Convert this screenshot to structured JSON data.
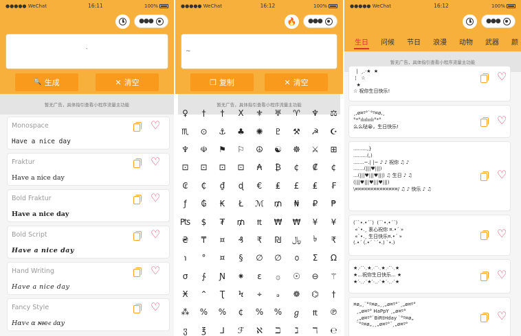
{
  "status": {
    "carrier": "●●●●● WeChat",
    "battery": "100%"
  },
  "phones": [
    {
      "time": "16:11"
    },
    {
      "time": "16:12"
    },
    {
      "time": "16:12"
    }
  ],
  "colors": {
    "theme": "#f7b03c",
    "button": "#f99a1c",
    "heart": "#e8395a",
    "active_tab": "#d9342b"
  },
  "icons": {
    "copy": "copy-icon",
    "favorite": "heart-icon",
    "history": "clock-icon",
    "hot": "fire-icon",
    "more": "more-dots-icon",
    "close": "target-icon"
  },
  "editor": {
    "p1_value": "`",
    "p2_value": "~"
  },
  "actions": {
    "generate": "生成",
    "clear": "清空",
    "copy": "复制",
    "generate_icon": "🔍",
    "clear_icon": "✕",
    "copy_icon": "❐"
  },
  "ad_text": "暂无广告，具体指引查看小程序流量主功能",
  "fonts": [
    {
      "name": "Monospace",
      "sample": "Have a nice day"
    },
    {
      "name": "Fraktur",
      "sample": "Have a nice day"
    },
    {
      "name": "Bold Fraktur",
      "sample": "Have a nice day"
    },
    {
      "name": "Bold Script",
      "sample": "Have a nice day"
    },
    {
      "name": "Hand Writing",
      "sample": "Have a nice day"
    },
    {
      "name": "Fancy Style",
      "sample": "Hɑᴠҽ ɑ ɴ̶ɪ̶ᴄ̶ҽ ԁɑу"
    }
  ],
  "symbols": [
    "♀",
    "†",
    "†",
    "Ⅹ",
    "⚜",
    "♅",
    "♈",
    "♆",
    "⚖",
    "♏",
    "⊙",
    "⚓",
    "♣",
    "✺",
    "♇",
    "⚒",
    "☭",
    "☪",
    "♆",
    "☫",
    "⚑",
    "⚐",
    "☮",
    "☯",
    "☸",
    "⚔",
    "⊞",
    "⊡",
    "⊡",
    "⊡",
    "⊡",
    "₳",
    "₿",
    "¢",
    "₡",
    "¢",
    "₢",
    "₵",
    "₫",
    "ɖ",
    "€",
    "₤",
    "£",
    "₤",
    "₣",
    "ƒ",
    "₲",
    "₭",
    "Ł",
    "ℳ",
    "₥",
    "₦",
    "₽",
    "₱",
    "₧",
    "$",
    "₮",
    "₥",
    "₶",
    "₩",
    "₩",
    "¥",
    "¥",
    "₴",
    "₸",
    "¤",
    "₰",
    "₹",
    "₪",
    "﷼",
    "৳",
    "₹",
    "℩",
    "°",
    "¤",
    "§",
    "∅",
    "∅",
    "൦",
    "Ʃ",
    "Ω",
    "σ",
    "∱",
    "Ɲ",
    "⁕",
    "ε",
    "۞",
    "☉",
    "⊖",
    "⚚",
    "Ӿ",
    "⌃",
    "Ʈ",
    "Ϟ",
    "⌖",
    "ₔ",
    "❁",
    "⌬",
    "†",
    "⁂",
    "%",
    "%",
    "¢",
    "%",
    "%",
    "ℊ",
    "₶",
    "℗",
    "ჳ",
    "℥",
    "⅃",
    "ℱ",
    "ℵ",
    "ℶ",
    "ℷ",
    "ℸ",
    "℮"
  ],
  "tabs": [
    "生日",
    "问候",
    "节日",
    "浪漫",
    "动物",
    "武器",
    "颜"
  ],
  "kaomoji": [
    "  |  ¸.·★  ★\n ¦   ☆\n  ★\n☆ 祝你生日快乐!",
    "¸,ø¤º°`°º¤ø,¸\n°*°ılıılııılı°*°\n么么哒😀，生日快乐!",
    ".........,}\n.........(,)\n.......~.| |~ ♪ ♪ 祝你 ♫ ♪\n.......(|||♥|||)\n...(|||♥|||♥|||) ♫ 生日 ♪ ♫\n(|||♥|||♥|||♥|||)\n\\¤¤¤¤¤¤¤¤¤¤¤¤¤¤/ ♫ ♪ 快乐 ♪ ♫",
    "(¨`•.•´¨)  (¨`•.•´¨)\n «`•.¸ 衷心祝你 ¤.•´ »\n «`•.¸ 生日快乐¤.•´ »\n(.•´ (.•´ `´•.) `•.)",
    "★⋰⋱★⋰⋱★⋰⋱★\n★...祝你生日快乐... ★\n★⋱⋰★⋱⋰★⋱⋰★",
    "¤ø„¸¨°º¤ø„¸¸„ø¤º°¨¸„ø¤º°\n  ¸„ø¤º° HaPpY ¸„ø¤º°\n  ¸„ø¤º°`BiRtHday `°º¤ø„\n  ¨°º¤ø„¸¸„ø¤º°¨¸„ø¤º°"
  ]
}
